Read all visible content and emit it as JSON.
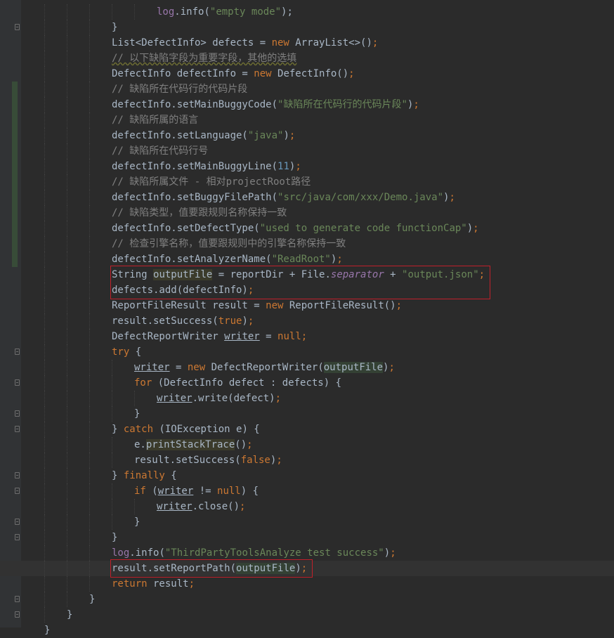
{
  "editor": {
    "language": "java",
    "lines": [
      {
        "indent": 6,
        "tokens": [
          [
            "fld",
            "log"
          ],
          [
            "",
            "."
          ],
          [
            "",
            "info("
          ],
          [
            "str",
            "\"empty mode\""
          ],
          [
            "",
            ");"
          ]
        ]
      },
      {
        "indent": 4,
        "fold": true,
        "tokens": [
          [
            "",
            "}"
          ]
        ]
      },
      {
        "indent": 4,
        "tokens": [
          [
            "",
            "List<DefectInfo> defects = "
          ],
          [
            "kw",
            "new"
          ],
          [
            "",
            " ArrayList<>()"
          ],
          [
            "kw",
            ";"
          ]
        ]
      },
      {
        "indent": 4,
        "tokens": [
          [
            "cmt wavy",
            "// 以下缺陷字段为重要字段，其他的选填"
          ]
        ]
      },
      {
        "indent": 4,
        "tokens": [
          [
            "",
            "DefectInfo defectInfo = "
          ],
          [
            "kw",
            "new"
          ],
          [
            "",
            " DefectInfo()"
          ],
          [
            "kw",
            ";"
          ]
        ]
      },
      {
        "indent": 4,
        "change": true,
        "tokens": [
          [
            "cmt",
            "// 缺陷所在代码行的代码片段"
          ]
        ]
      },
      {
        "indent": 4,
        "change": true,
        "tokens": [
          [
            "",
            "defectInfo.setMainBuggyCode("
          ],
          [
            "str",
            "\"缺陷所在代码行的代码片段\""
          ],
          [
            "",
            ")"
          ],
          [
            "kw",
            ";"
          ]
        ]
      },
      {
        "indent": 4,
        "change": true,
        "tokens": [
          [
            "cmt",
            "// 缺陷所属的语言"
          ]
        ]
      },
      {
        "indent": 4,
        "change": true,
        "tokens": [
          [
            "",
            "defectInfo.setLanguage("
          ],
          [
            "str",
            "\"java\""
          ],
          [
            "",
            ")"
          ],
          [
            "kw",
            ";"
          ]
        ]
      },
      {
        "indent": 4,
        "change": true,
        "tokens": [
          [
            "cmt",
            "// 缺陷所在代码行号"
          ]
        ]
      },
      {
        "indent": 4,
        "change": true,
        "tokens": [
          [
            "",
            "defectInfo.setMainBuggyLine("
          ],
          [
            "num",
            "11"
          ],
          [
            "",
            ")"
          ],
          [
            "kw",
            ";"
          ]
        ]
      },
      {
        "indent": 4,
        "change": true,
        "tokens": [
          [
            "cmt",
            "// 缺陷所属文件 - 相对projectRoot路径"
          ]
        ]
      },
      {
        "indent": 4,
        "change": true,
        "tokens": [
          [
            "",
            "defectInfo.setBuggyFilePath("
          ],
          [
            "str",
            "\"src/java/com/xxx/Demo.java\""
          ],
          [
            "",
            ")"
          ],
          [
            "kw",
            ";"
          ]
        ]
      },
      {
        "indent": 4,
        "change": true,
        "tokens": [
          [
            "cmt",
            "// 缺陷类型，值要跟规则名称保持一致"
          ]
        ]
      },
      {
        "indent": 4,
        "change": true,
        "tokens": [
          [
            "",
            "defectInfo.setDefectType("
          ],
          [
            "str",
            "\"used to generate code functionCap\""
          ],
          [
            "",
            ")"
          ],
          [
            "kw",
            ";"
          ]
        ]
      },
      {
        "indent": 4,
        "change": true,
        "tokens": [
          [
            "cmt",
            "// 检查引擎名称，值要跟规则中的引擎名称保持一致"
          ]
        ]
      },
      {
        "indent": 4,
        "change": true,
        "tokens": [
          [
            "",
            "defectInfo.setAnalyzerName("
          ],
          [
            "str",
            "\"ReadRoot\""
          ],
          [
            "",
            ")"
          ],
          [
            "kw",
            ";"
          ]
        ]
      },
      {
        "indent": 4,
        "tokens": [
          [
            "",
            "String "
          ],
          [
            "usage",
            "outputFile"
          ],
          [
            "",
            " = reportDir + File."
          ],
          [
            "sfld",
            "separator"
          ],
          [
            "",
            " + "
          ],
          [
            "str",
            "\"output.json\""
          ],
          [
            "kw",
            ";"
          ]
        ]
      },
      {
        "indent": 4,
        "tokens": [
          [
            "",
            "defects.add(defectInfo)"
          ],
          [
            "kw",
            ";"
          ]
        ]
      },
      {
        "indent": 4,
        "tokens": [
          [
            "",
            "ReportFileResult result = "
          ],
          [
            "kw",
            "new"
          ],
          [
            "",
            " ReportFileResult()"
          ],
          [
            "kw",
            ";"
          ]
        ]
      },
      {
        "indent": 4,
        "tokens": [
          [
            "",
            "result.setSuccess("
          ],
          [
            "kw",
            "true"
          ],
          [
            "",
            ")"
          ],
          [
            "kw",
            ";"
          ]
        ]
      },
      {
        "indent": 4,
        "tokens": [
          [
            "",
            "DefectReportWriter "
          ],
          [
            "ul",
            "writer"
          ],
          [
            "",
            " = "
          ],
          [
            "kw",
            "null"
          ],
          [
            "kw",
            ";"
          ]
        ]
      },
      {
        "indent": 4,
        "fold": true,
        "tokens": [
          [
            "kw",
            "try"
          ],
          [
            "",
            " {"
          ]
        ]
      },
      {
        "indent": 5,
        "tokens": [
          [
            "ul",
            "writer"
          ],
          [
            "",
            " = "
          ],
          [
            "kw",
            "new"
          ],
          [
            "",
            " DefectReportWriter("
          ],
          [
            "hl",
            "outputFile"
          ],
          [
            "",
            ")"
          ],
          [
            "kw",
            ";"
          ]
        ]
      },
      {
        "indent": 5,
        "fold": true,
        "tokens": [
          [
            "kw",
            "for"
          ],
          [
            "",
            " (DefectInfo defect : defects) {"
          ]
        ]
      },
      {
        "indent": 6,
        "tokens": [
          [
            "ul",
            "writer"
          ],
          [
            "",
            ".write(defect)"
          ],
          [
            "kw",
            ";"
          ]
        ]
      },
      {
        "indent": 5,
        "fold": true,
        "tokens": [
          [
            "",
            "}"
          ]
        ]
      },
      {
        "indent": 4,
        "fold": true,
        "tokens": [
          [
            "",
            "} "
          ],
          [
            "kw",
            "catch"
          ],
          [
            "",
            " (IOException e) {"
          ]
        ]
      },
      {
        "indent": 5,
        "tokens": [
          [
            "",
            "e."
          ],
          [
            "usage",
            "printStackTrace"
          ],
          [
            "",
            "()"
          ],
          [
            "kw",
            ";"
          ]
        ]
      },
      {
        "indent": 5,
        "tokens": [
          [
            "",
            "result.setSuccess("
          ],
          [
            "kw",
            "false"
          ],
          [
            "",
            ")"
          ],
          [
            "kw",
            ";"
          ]
        ]
      },
      {
        "indent": 4,
        "fold": true,
        "tokens": [
          [
            "",
            "} "
          ],
          [
            "kw",
            "finally"
          ],
          [
            "",
            " {"
          ]
        ]
      },
      {
        "indent": 5,
        "fold": true,
        "tokens": [
          [
            "kw",
            "if"
          ],
          [
            "",
            " ("
          ],
          [
            "ul",
            "writer"
          ],
          [
            "",
            " != "
          ],
          [
            "kw",
            "null"
          ],
          [
            "",
            ") {"
          ]
        ]
      },
      {
        "indent": 6,
        "tokens": [
          [
            "ul",
            "writer"
          ],
          [
            "",
            ".close()"
          ],
          [
            "kw",
            ";"
          ]
        ]
      },
      {
        "indent": 5,
        "fold": true,
        "tokens": [
          [
            "",
            "}"
          ]
        ]
      },
      {
        "indent": 4,
        "fold": true,
        "tokens": [
          [
            "",
            "}"
          ]
        ]
      },
      {
        "indent": 4,
        "tokens": [
          [
            "fld",
            "log"
          ],
          [
            "",
            ".info("
          ],
          [
            "str",
            "\"ThirdPartyToolsAnalyze test success\""
          ],
          [
            "",
            ")"
          ],
          [
            "kw",
            ";"
          ]
        ]
      },
      {
        "indent": 4,
        "current": true,
        "tokens": [
          [
            "",
            "result.setReportPath("
          ],
          [
            "hl",
            "outputFile"
          ],
          [
            "",
            ")"
          ],
          [
            "kw",
            ";"
          ]
        ]
      },
      {
        "indent": 4,
        "tokens": [
          [
            "kw",
            "return"
          ],
          [
            "",
            " result"
          ],
          [
            "kw",
            ";"
          ]
        ]
      },
      {
        "indent": 3,
        "fold": true,
        "tokens": [
          [
            "",
            "}"
          ]
        ]
      },
      {
        "indent": 2,
        "fold": true,
        "tokens": [
          [
            "",
            "}"
          ]
        ]
      },
      {
        "indent": 1,
        "tokens": [
          [
            "",
            "}"
          ]
        ]
      }
    ]
  },
  "highlights": [
    {
      "name": "highlight-box-output-file",
      "from_line": 17,
      "to_line": 18
    },
    {
      "name": "highlight-box-set-report-path",
      "from_line": 36,
      "to_line": 36
    }
  ],
  "colors": {
    "background": "#2b2b2b",
    "gutter": "#313335",
    "keyword": "#cc7832",
    "string": "#6a8759",
    "number": "#6897bb",
    "comment": "#808080",
    "field": "#9876aa",
    "annotation_box": "#c0202a"
  }
}
